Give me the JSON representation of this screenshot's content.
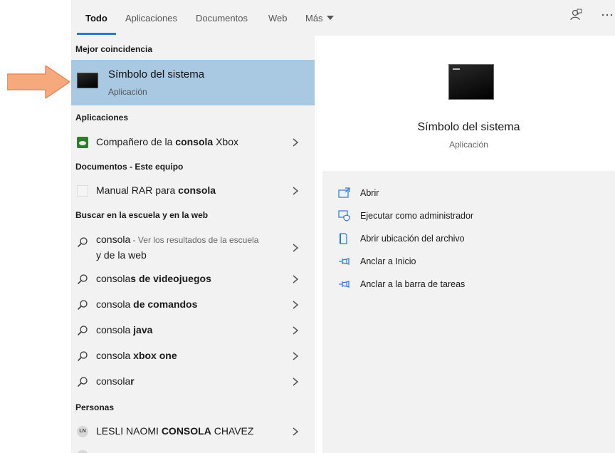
{
  "tabs": [
    {
      "label": "Todo"
    },
    {
      "label": "Aplicaciones"
    },
    {
      "label": "Documentos"
    },
    {
      "label": "Web"
    },
    {
      "label": "Más"
    }
  ],
  "sections": {
    "best": "Mejor coincidencia",
    "apps": "Aplicaciones",
    "docs": "Documentos - Este equipo",
    "web": "Buscar en la escuela y en la web",
    "people": "Personas"
  },
  "best_match": {
    "title": "Símbolo del sistema",
    "subtitle": "Aplicación"
  },
  "apps": [
    {
      "pre": "Compañero de la ",
      "bold": "consola",
      "post": " Xbox"
    }
  ],
  "documents": [
    {
      "pre": "Manual RAR para ",
      "bold": "consola",
      "post": ""
    }
  ],
  "web": {
    "first": {
      "text": "consola",
      "hint_line1": " - Ver los resultados de la escuela",
      "hint_line2": "y de la web"
    },
    "items": [
      {
        "pre": "consola",
        "bold": "s de videojuegos"
      },
      {
        "pre": "consola ",
        "bold": "de comandos"
      },
      {
        "pre": "consola ",
        "bold": "java"
      },
      {
        "pre": "consola ",
        "bold": "xbox one"
      },
      {
        "pre": "consola",
        "bold": "r"
      }
    ]
  },
  "people": [
    {
      "initials": "LN",
      "pre": "LESLI NAOMI ",
      "bold": "CONSOLA",
      "post": " CHAVEZ"
    }
  ],
  "preview": {
    "title": "Símbolo del sistema",
    "subtitle": "Aplicación"
  },
  "actions": [
    {
      "label": "Abrir"
    },
    {
      "label": "Ejecutar como administrador"
    },
    {
      "label": "Abrir ubicación del archivo"
    },
    {
      "label": "Anclar a Inicio"
    },
    {
      "label": "Anclar a la barra de tareas"
    }
  ],
  "colors": {
    "accent": "#2b78d6",
    "selection": "#a9c8e2",
    "arrow": "#f4a57a",
    "icon_blue": "#2b78d6"
  }
}
